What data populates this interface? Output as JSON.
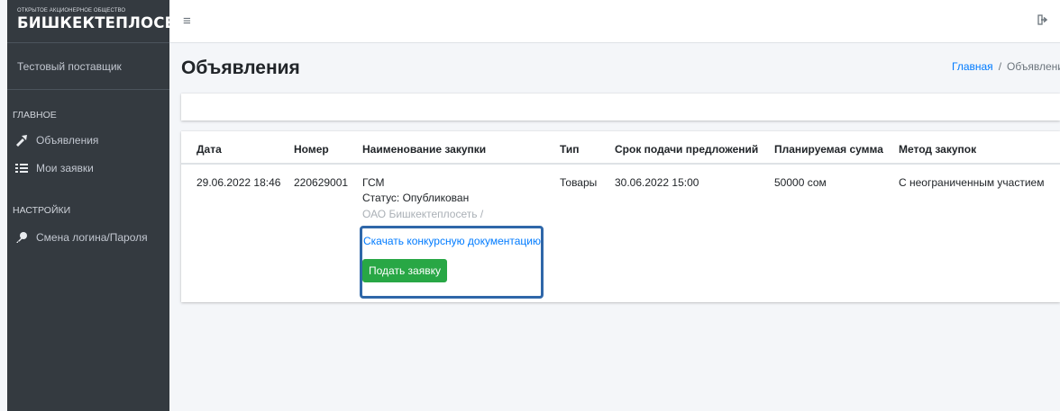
{
  "brand": {
    "subtitle": "ОТКРЫТОЕ АКЦИОНЕРНОЕ ОБЩЕСТВО",
    "name": "БИШКЕКТЕПЛОСЕТЬ"
  },
  "user": {
    "name": "Тестовый поставщик"
  },
  "sidebar": {
    "section_main": "ГЛАВНОЕ",
    "section_settings": "НАСТРОЙКИ",
    "items": [
      {
        "label": "Объявления",
        "icon": "bullhorn-icon"
      },
      {
        "label": "Мои заявки",
        "icon": "list-icon"
      },
      {
        "label": "Смена логина/Пароля",
        "icon": "key-icon"
      }
    ]
  },
  "topbar": {
    "menu_icon": "hamburger-icon",
    "logout_icon": "sign-out-icon"
  },
  "page": {
    "title": "Объявления"
  },
  "breadcrumb": {
    "home": "Главная",
    "separator": "/",
    "current": "Объявления"
  },
  "table": {
    "headers": [
      "Дата",
      "Номер",
      "Наименование закупки",
      "Тип",
      "Срок подачи предложений",
      "Планируемая сумма",
      "Метод закупок"
    ],
    "row": {
      "date": "29.06.2022 18:46",
      "number": "220629001",
      "name": "ГСМ",
      "status": "Статус: Опубликован",
      "org": "ОАО Бишкектеплосеть /",
      "type": "Товары",
      "deadline": "30.06.2022 15:00",
      "amount": "50000 сом",
      "method": "С неограниченным участием",
      "doc_link": "Скачать конкурсную документацию",
      "submit": "Подать заявку"
    }
  },
  "colors": {
    "sidebar_bg": "#343a40",
    "link": "#007bff",
    "success": "#28a745",
    "highlight": "#2f67a9"
  }
}
